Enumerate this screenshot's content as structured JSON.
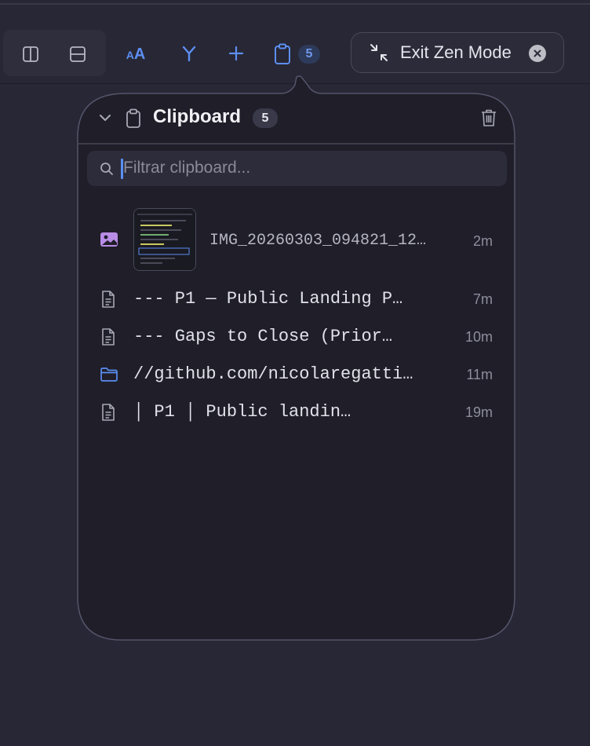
{
  "toolbar": {
    "buttons": [
      {
        "name": "split-vertical-icon",
        "label": ""
      },
      {
        "name": "split-horizontal-icon",
        "label": ""
      },
      {
        "name": "text-size-icon",
        "label": "AA"
      },
      {
        "name": "branch-icon",
        "label": ""
      },
      {
        "name": "plus-icon",
        "label": ""
      },
      {
        "name": "clipboard-icon",
        "label": ""
      }
    ],
    "clipboard_count": "5",
    "exit_zen_label": "Exit Zen Mode"
  },
  "popover": {
    "title": "Clipboard",
    "count": "5",
    "search_placeholder": "Filtrar clipboard...",
    "items": [
      {
        "type": "image",
        "icon": "image-icon",
        "text": "IMG_20260303_094821_12…",
        "time": "2m"
      },
      {
        "type": "text",
        "icon": "document-icon",
        "text": "---   P1 — Public Landing P…",
        "time": "7m"
      },
      {
        "type": "text",
        "icon": "document-icon",
        "text": "---   Gaps to Close (Prior…",
        "time": "10m"
      },
      {
        "type": "folder",
        "icon": "folder-icon",
        "text": "//github.com/nicolaregatti…",
        "time": "11m"
      },
      {
        "type": "text",
        "icon": "document-icon",
        "text": "│ P1       │ Public landin…",
        "time": "19m"
      }
    ]
  },
  "colors": {
    "background": "#282735",
    "accent": "#5c8ff2",
    "image_icon": "#b98ce6",
    "popover_bg": "#1f1e29"
  }
}
